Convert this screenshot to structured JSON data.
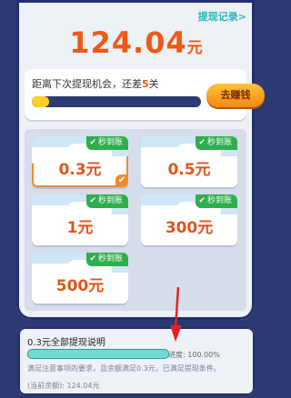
{
  "header": {
    "record_link": "提现记录>"
  },
  "balance": {
    "amount": "124.04",
    "unit": "元"
  },
  "progress": {
    "text_before": "距离下次提现机会，还差",
    "levels_left": "5",
    "text_after": "关",
    "fill_fraction": 0.1,
    "earn_button": "去赚钱"
  },
  "options": [
    {
      "amount": "0.3元",
      "badge": "秒到账",
      "selected": true
    },
    {
      "amount": "0.5元",
      "badge": "秒到账",
      "selected": false
    },
    {
      "amount": "1元",
      "badge": "秒到账",
      "selected": false
    },
    {
      "amount": "300元",
      "badge": "秒到账",
      "selected": false
    },
    {
      "amount": "500元",
      "badge": "秒到账",
      "selected": false
    }
  ],
  "info": {
    "title": "0.3元全部提现说明",
    "progress_label": "进度: 100.00%",
    "description": "满足注意事项的要求，且余额满足0.3元，已满足提现条件。",
    "current_balance": "(当前余额): 124.04元"
  },
  "colors": {
    "accent": "#ee5a17",
    "badge_green": "#2fae4d",
    "background": "#2b3a73"
  },
  "icons": {
    "badge_check": "check-circle-icon",
    "selected_corner": "check-icon",
    "annotation": "red-arrow-icon"
  }
}
